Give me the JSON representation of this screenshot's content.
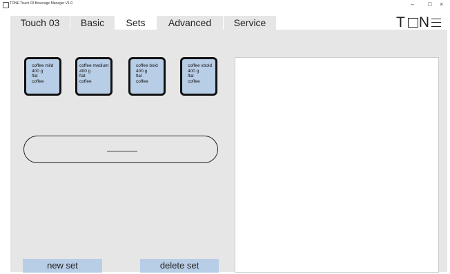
{
  "window": {
    "title": "TONE Touch 03   Beverage Manager   V1.0",
    "minimize": "–",
    "maximize": "□",
    "close": "×"
  },
  "tabs": [
    {
      "label": "Touch 03",
      "active": false
    },
    {
      "label": "Basic",
      "active": false
    },
    {
      "label": "Sets",
      "active": true
    },
    {
      "label": "Advanced",
      "active": false
    },
    {
      "label": "Service",
      "active": false
    }
  ],
  "logo": {
    "letters": [
      "T",
      "N"
    ]
  },
  "sets": [
    {
      "name": "coffee mild",
      "weight": "400 g",
      "shape": "flat",
      "type": "coffee"
    },
    {
      "name": "coffee medium",
      "weight": "400 g",
      "shape": "flat",
      "type": "coffee"
    },
    {
      "name": "coffee bold",
      "weight": "400 g",
      "shape": "flat",
      "type": "coffee"
    },
    {
      "name": "coffee xbold",
      "weight": "400 g",
      "shape": "flat",
      "type": "coffee"
    }
  ],
  "buttons": {
    "new_set": "new set",
    "delete_set": "delete set"
  },
  "colors": {
    "accent": "#b8cde6",
    "tab_bg": "#e6e6e6",
    "content_bg": "#e6e6e6"
  }
}
